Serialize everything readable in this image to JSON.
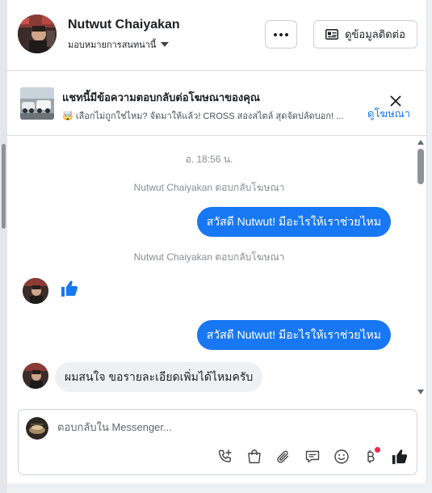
{
  "header": {
    "contact_name": "Nutwut Chaiyakan",
    "assign_label": "มอบหมายการสนทนานี้",
    "more_label": "...",
    "info_button_label": "ดูข้อมูลติดต่อ"
  },
  "ad_bar": {
    "title": "แชทนี้มีข้อความตอบกลับต่อโฆษณาของคุณ",
    "subtitle": "🤯 เลือกไม่ถูกใช่ไหม? จัดมาให้แล้ว! CROSS สองสไตล์ สุดจัดปลัดบอก! ...",
    "view_ad_label": "ดูโฆษณา"
  },
  "conversation": {
    "timestamp": "อ. 18:56 น.",
    "system_1": "Nutwut Chaiyakan ตอบกลับโฆษณา",
    "outgoing_1": "สวัสดี Nutwut! มีอะไรให้เราช่วยไหม",
    "system_2": "Nutwut Chaiyakan ตอบกลับโฆษณา",
    "outgoing_2": "สวัสดี Nutwut! มีอะไรให้เราช่วยไหม",
    "incoming_1": "ผมสนใจ ขอรายละเอียดเพิ่มได้ไหมครับ"
  },
  "composer": {
    "placeholder": "ตอบกลับใน Messenger...",
    "tools": [
      "phone-plus-icon",
      "shopping-bag-icon",
      "paperclip-icon",
      "quick-reply-icon",
      "emoji-icon",
      "baht-icon",
      "thumbs-up-icon"
    ]
  },
  "colors": {
    "accent": "#1877f2",
    "bubble_incoming": "#eef0f2",
    "muted_text": "#8a8d91",
    "notification": "#f02849"
  }
}
